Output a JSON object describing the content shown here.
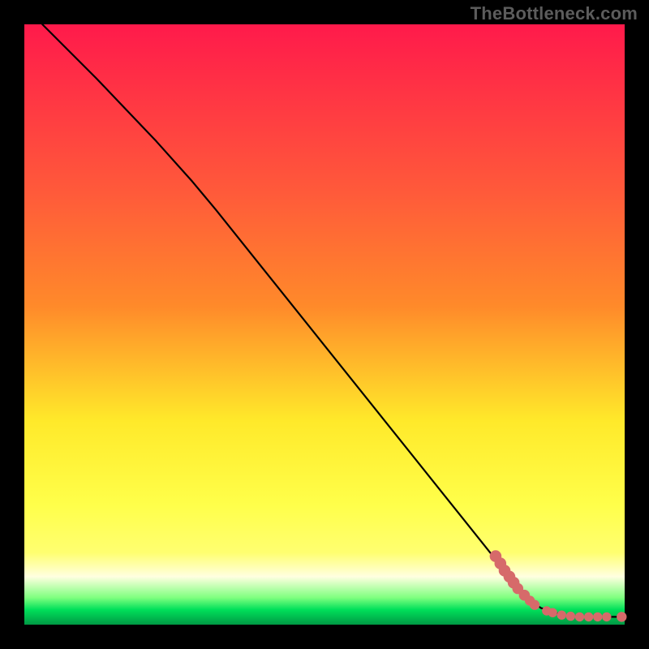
{
  "watermark": "TheBottleneck.com",
  "chart_data": {
    "type": "line",
    "title": "",
    "xlabel": "",
    "ylabel": "",
    "xlim": [
      0,
      100
    ],
    "ylim": [
      0,
      100
    ],
    "gradient_colors": {
      "top": "#ff1a4b",
      "mid_upper": "#ff8a2a",
      "mid": "#ffe92a",
      "mid_lower": "#ffff70",
      "bottom_band": "#ffffe0",
      "green_light": "#7fff7f",
      "green": "#00e05a",
      "green_deep": "#009944"
    },
    "curve": [
      {
        "x": 3.0,
        "y": 100.0
      },
      {
        "x": 12.0,
        "y": 91.0
      },
      {
        "x": 22.0,
        "y": 80.5
      },
      {
        "x": 28.0,
        "y": 73.8
      },
      {
        "x": 32.0,
        "y": 69.0
      },
      {
        "x": 40.0,
        "y": 59.0
      },
      {
        "x": 50.0,
        "y": 46.5
      },
      {
        "x": 60.0,
        "y": 34.0
      },
      {
        "x": 70.0,
        "y": 21.5
      },
      {
        "x": 78.0,
        "y": 11.5
      },
      {
        "x": 83.0,
        "y": 5.3
      },
      {
        "x": 86.0,
        "y": 2.8
      },
      {
        "x": 90.0,
        "y": 1.5
      },
      {
        "x": 95.0,
        "y": 1.3
      },
      {
        "x": 100.0,
        "y": 1.3
      }
    ],
    "dots_along_curve": [
      {
        "x": 78.5,
        "y": 11.4,
        "r": 1.4
      },
      {
        "x": 79.3,
        "y": 10.2,
        "r": 1.4
      },
      {
        "x": 80.0,
        "y": 9.0,
        "r": 1.4
      },
      {
        "x": 80.8,
        "y": 8.0,
        "r": 1.4
      },
      {
        "x": 81.5,
        "y": 7.0,
        "r": 1.4
      },
      {
        "x": 82.2,
        "y": 6.0,
        "r": 1.3
      },
      {
        "x": 83.3,
        "y": 4.9,
        "r": 1.3
      },
      {
        "x": 84.2,
        "y": 4.0,
        "r": 1.2
      },
      {
        "x": 85.0,
        "y": 3.3,
        "r": 1.2
      },
      {
        "x": 87.0,
        "y": 2.3,
        "r": 1.1
      },
      {
        "x": 88.0,
        "y": 2.0,
        "r": 1.1
      },
      {
        "x": 89.5,
        "y": 1.6,
        "r": 1.1
      },
      {
        "x": 91.0,
        "y": 1.4,
        "r": 1.1
      },
      {
        "x": 92.5,
        "y": 1.3,
        "r": 1.1
      },
      {
        "x": 94.0,
        "y": 1.3,
        "r": 1.1
      },
      {
        "x": 95.5,
        "y": 1.3,
        "r": 1.1
      },
      {
        "x": 97.0,
        "y": 1.3,
        "r": 1.1
      },
      {
        "x": 99.5,
        "y": 1.3,
        "r": 1.2
      }
    ],
    "dot_color": "#d66a6a"
  }
}
